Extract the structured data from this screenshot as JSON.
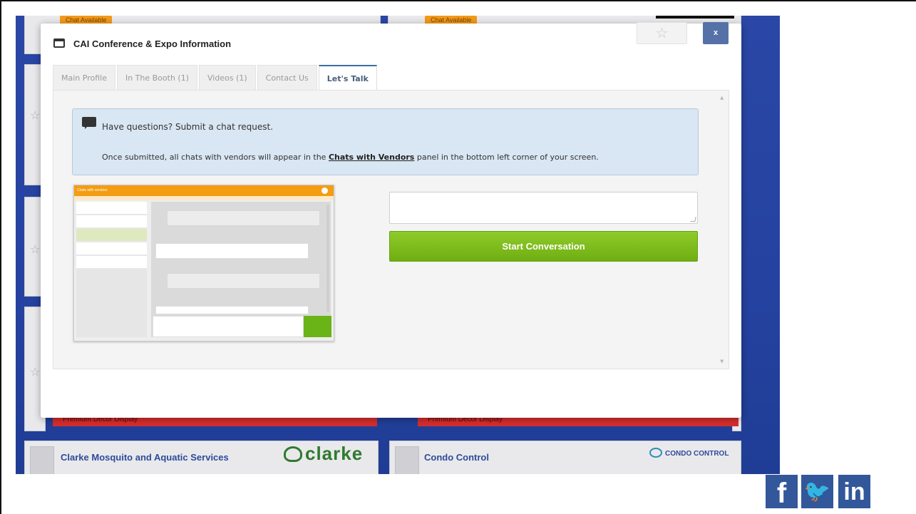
{
  "modal": {
    "title": "CAI Conference & Expo Information",
    "close_label": "x",
    "favorite_glyph": "☆"
  },
  "tabs": [
    {
      "label": "Main Profile",
      "active": false
    },
    {
      "label": "In The Booth (1)",
      "active": false
    },
    {
      "label": "Videos (1)",
      "active": false
    },
    {
      "label": "Contact Us",
      "active": false
    },
    {
      "label": "Let's Talk",
      "active": true
    }
  ],
  "info": {
    "question": "Have questions? Submit a chat request.",
    "text_before": "Once submitted, all chats with vendors will appear in the ",
    "link": "Chats with Vendors",
    "text_after": " panel in the bottom left corner of your screen."
  },
  "preview": {
    "header": "Chats with vendors"
  },
  "chat_form": {
    "message_value": "",
    "start_button": "Start Conversation"
  },
  "background": {
    "chat_pill_left": "Chat Available",
    "chat_pill_right": "Chat Available",
    "red_bar_left": "Premium Decor Display",
    "red_bar_right": "Premium Decor Display",
    "vendor_left": "Clarke Mosquito and Aquatic Services",
    "vendor_left_logo": "clarke",
    "vendor_right": "Condo Control",
    "vendor_right_logo": "CONDO CONTROL"
  },
  "social": {
    "facebook": "f",
    "twitter": "🐦",
    "linkedin": "in"
  },
  "colors": {
    "accent_blue": "#2542a0",
    "button_green": "#6fae12",
    "chat_orange": "#f29a1a",
    "alert_red": "#d62d2d",
    "social_blue": "#32579a"
  }
}
